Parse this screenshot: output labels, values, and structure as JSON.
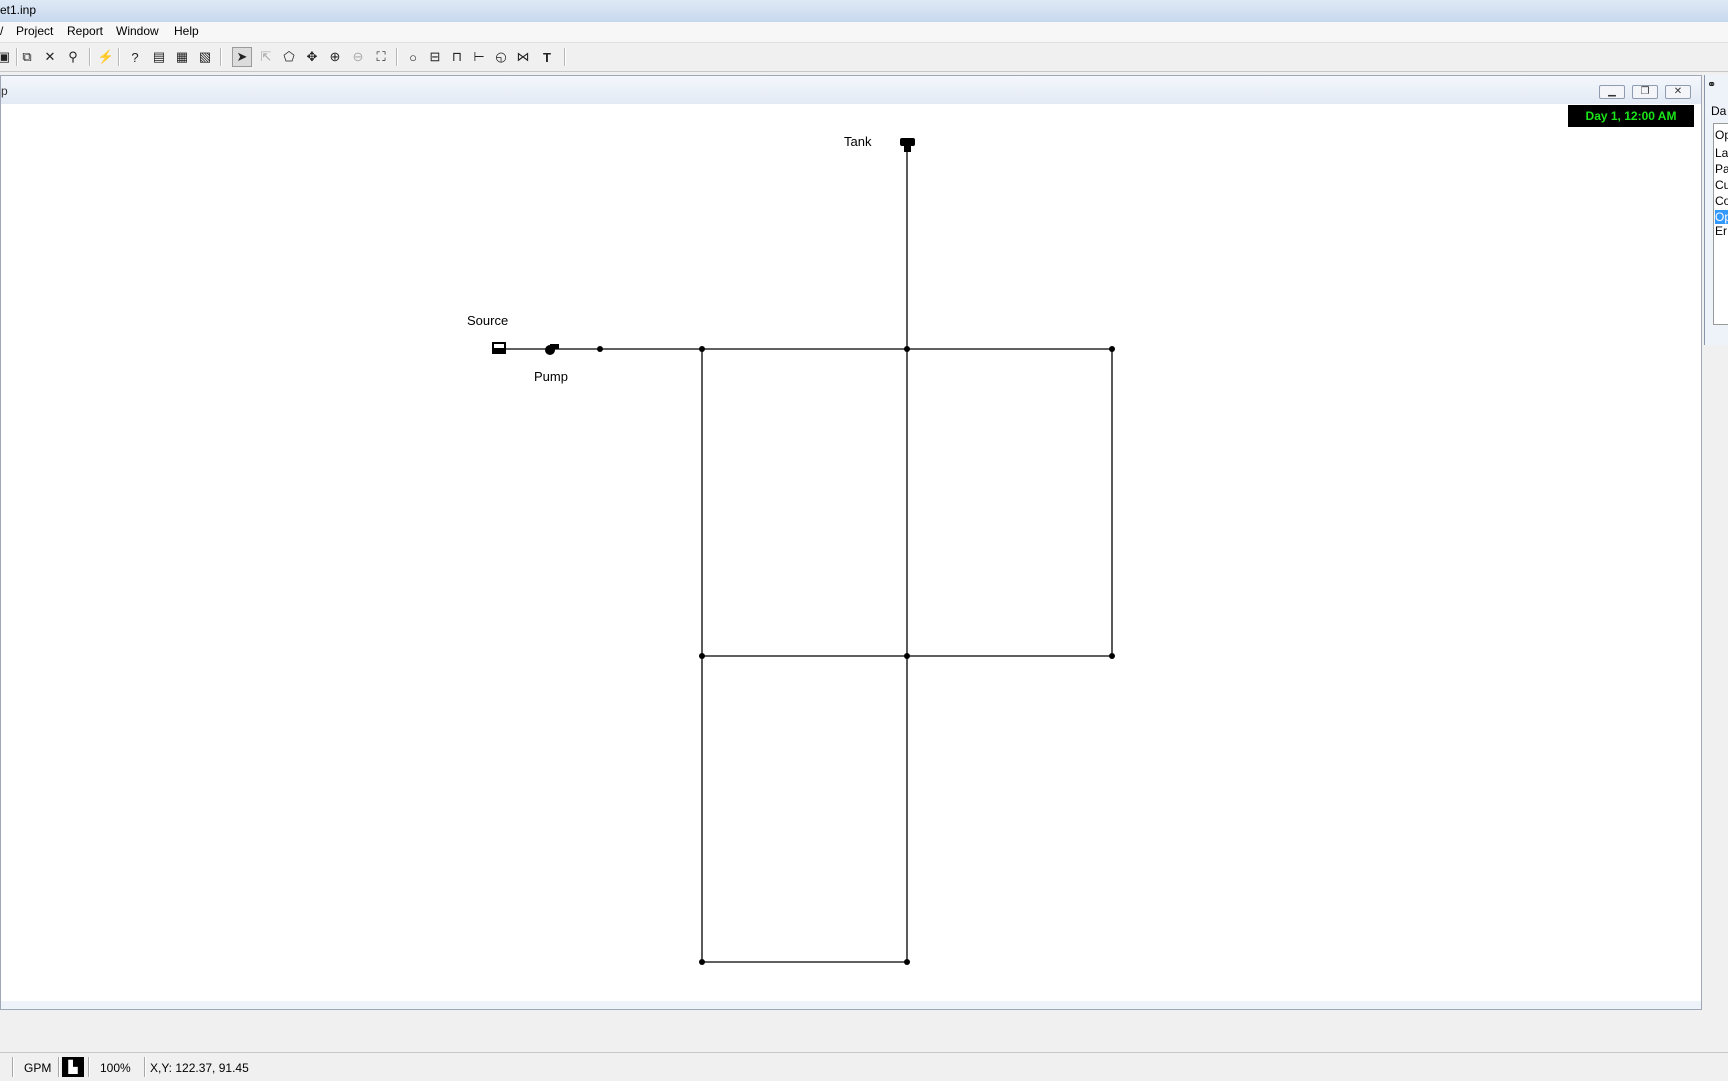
{
  "title": "et1.inp",
  "menu": [
    "Project",
    "Report",
    "Window",
    "Help"
  ],
  "map_window": {
    "title": "p",
    "clock": "Day 1, 12:00 AM"
  },
  "labels": {
    "tank": "Tank",
    "source": "Source",
    "pump": "Pump"
  },
  "browser_panel": {
    "header": "Da",
    "items": [
      "Op",
      "La",
      "Pa",
      "Cu",
      "Co",
      "Op",
      "Er"
    ],
    "selected_index": 5
  },
  "status": {
    "flow_units": "GPM",
    "zoom": "100%",
    "coords": "X,Y: 122.37, 91.45"
  }
}
